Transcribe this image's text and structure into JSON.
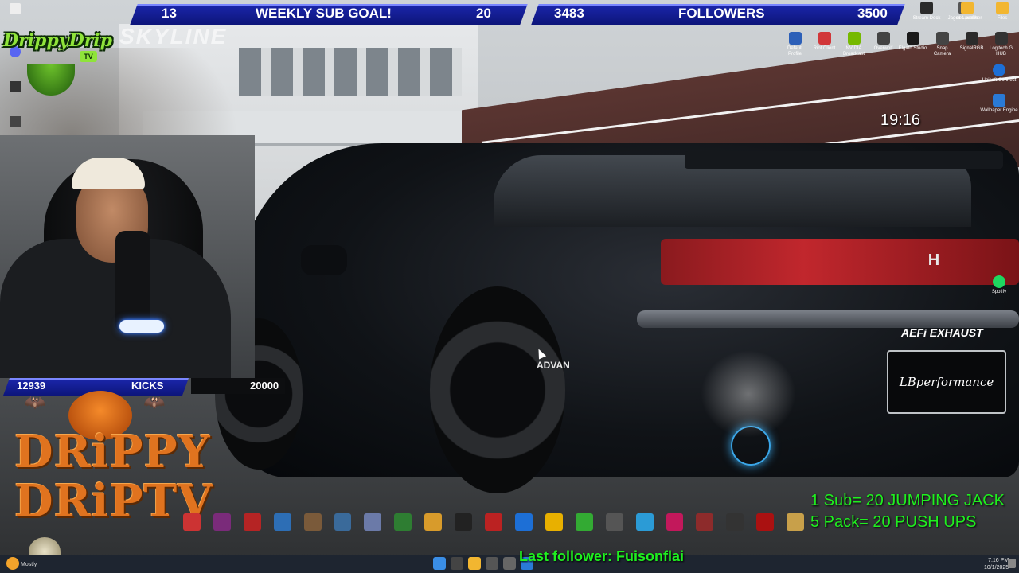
{
  "stream": {
    "sub_goal": {
      "current": "13",
      "label": "WEEKLY SUB GOAL!",
      "target": "20"
    },
    "followers": {
      "current": "3483",
      "label": "FOLLOWERS",
      "target": "3500"
    },
    "kicks": {
      "current": "12939",
      "label": "KICKS",
      "target": "20000"
    },
    "brand_logo": {
      "text": "DrippyDrip",
      "sub": "TV"
    },
    "halloween_logo": {
      "line1": "DRiPPY",
      "line2": "DRiPTV"
    },
    "skyline_watermark": "SKYLINE",
    "clock": "19:16",
    "rule_lines": [
      "1 Sub= 20 JUMPING JACK",
      "5 Pack= 20 PUSH UPS"
    ],
    "last_follower": "Last follower: Fuisonflai"
  },
  "car": {
    "badge_advan": "ADVAN",
    "exhaust": "AEFi EXHAUST",
    "plate": "LBperformance",
    "honda": "H"
  },
  "desktop_right_icons": [
    {
      "label": "Default Profile"
    },
    {
      "label": "Riot Client"
    },
    {
      "label": "NVIDIA Broadcast"
    },
    {
      "label": "Overwolf"
    },
    {
      "label": "Elgato Studio"
    },
    {
      "label": "Snap Camera"
    },
    {
      "label": "SignalRGB"
    },
    {
      "label": "Logitech G HUB"
    }
  ],
  "desktop_top_icons": [
    {
      "label": "Stream Deck"
    },
    {
      "label": "Jagex Launcher"
    },
    {
      "label": "obs profile"
    },
    {
      "label": "Files"
    }
  ],
  "side_icons": [
    {
      "label": "Ubisoft Connect"
    },
    {
      "label": "Wallpaper Engine"
    },
    {
      "label": "Spotify"
    }
  ],
  "taskbar": {
    "time": "7:16 PM",
    "date": "10/1/2025",
    "weather": "Mostly"
  },
  "colors": {
    "goal_bar": "#0d157a",
    "goal_bar_border": "#7a86ff",
    "rule_text": "#1ff01f",
    "last_follower_text": "#1ff01f",
    "halloween_orange": "#e0731f"
  }
}
